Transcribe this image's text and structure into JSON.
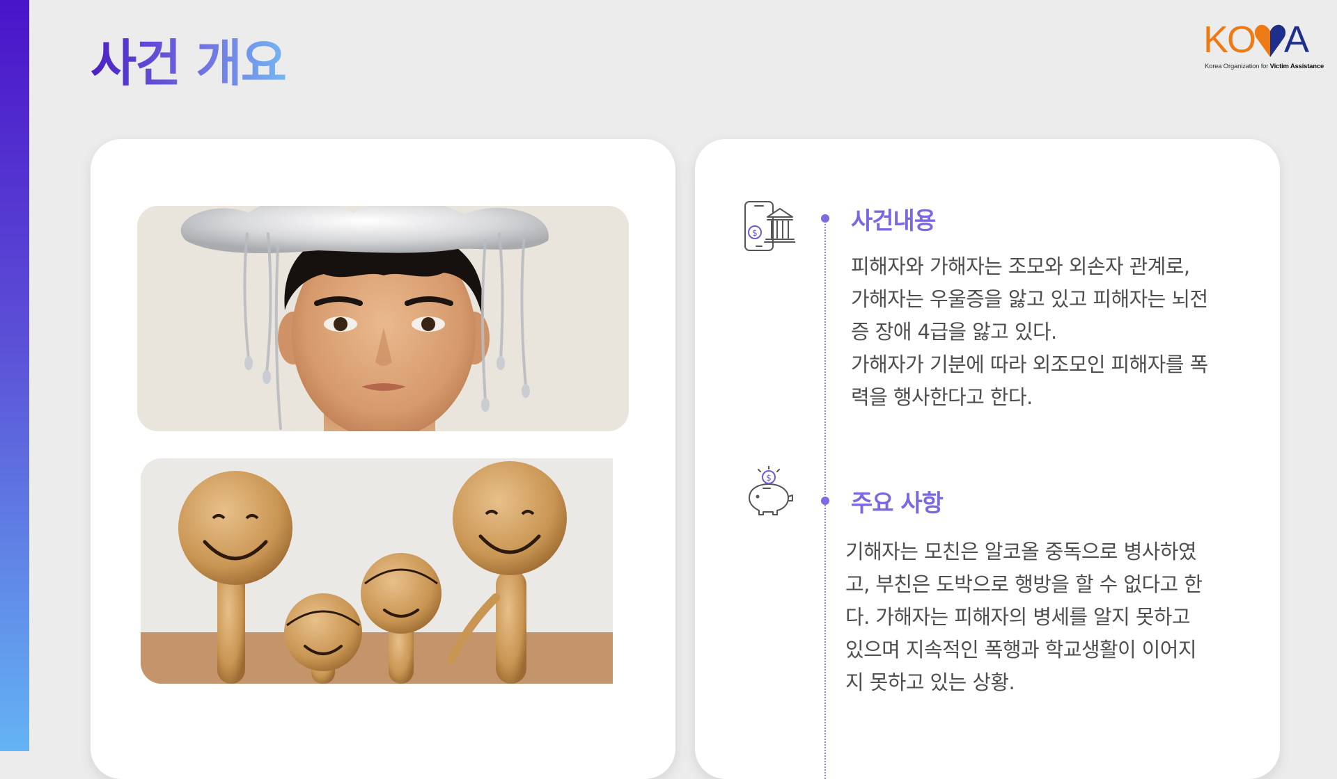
{
  "header": {
    "title": "사건 개요"
  },
  "logo": {
    "letters_left": "KO",
    "letters_right": "A",
    "tagline_prefix": "Korea Organization for",
    "tagline_bold": "Victim Assistance",
    "colors": {
      "orange": "#ee7a16",
      "navy": "#1d2f8c"
    }
  },
  "images": {
    "sad_boy": {
      "icon": "boy-under-rain-cloud-photo"
    },
    "family": {
      "icon": "wooden-family-figures-photo"
    }
  },
  "sections": [
    {
      "icon": "mobile-bank-icon",
      "heading": "사건내용",
      "body": "피해자와 가해자는 조모와 외손자 관계로,\n가해자는 우울증을 앓고 있고 피해자는 뇌전\n증 장애 4급을 앓고 있다.\n가해자가 기분에 따라 외조모인 피해자를 폭\n력을 행사한다고 한다."
    },
    {
      "icon": "piggy-bank-icon",
      "heading": "주요 사항",
      "body": "기해자는 모친은 알코올 중독으로 병사하였\n고, 부친은 도박으로 행방을 할 수 없다고 한\n다. 가해자는 피해자의 병세를 알지 못하고\n있으며 지속적인 폭행과 학교생활이 이어지\n지 못하고 있는 상황."
    }
  ],
  "theme": {
    "accent": "#7a68e2",
    "sidebar_top": "#4a14c9",
    "sidebar_bottom": "#64b3f4",
    "background": "#ececec"
  }
}
